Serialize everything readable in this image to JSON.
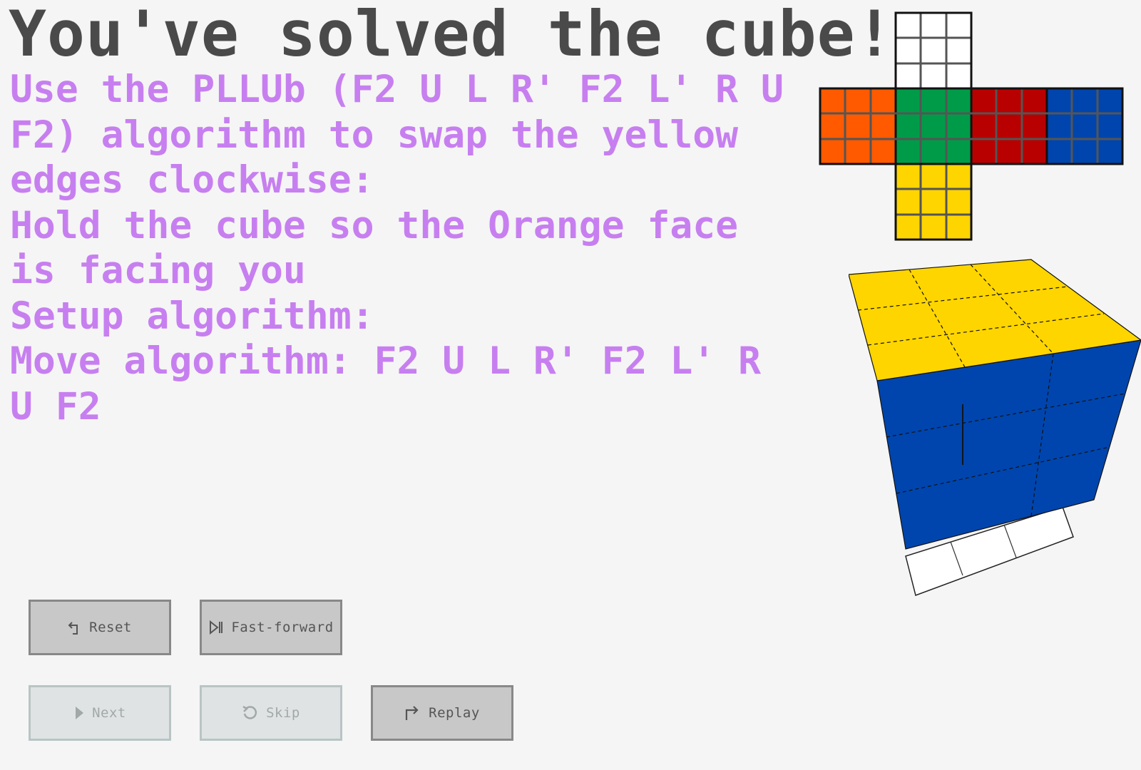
{
  "title": "You've solved the cube!",
  "instructions": {
    "line1": "Use the PLLUb (F2 U L R' F2 L' R U F2) algorithm to swap the yellow edges clockwise:",
    "line2": "Hold the cube so the Orange face is facing you",
    "line3": "Setup algorithm:",
    "line4": "Move algorithm: F2 U L R' F2 L' R U F2"
  },
  "cube_net": {
    "faces": {
      "top": "#ffffff",
      "left": "#ff5a00",
      "front": "#009b48",
      "right": "#b90000",
      "back": "#0045ad",
      "bottom": "#ffd500"
    }
  },
  "cube_3d": {
    "top_color": "#ffd500",
    "front_color": "#0045ad",
    "bottom_color": "#ffffff"
  },
  "buttons": {
    "reset": {
      "label": "Reset",
      "icon": "undo-icon",
      "enabled": true
    },
    "fast_forward": {
      "label": "Fast-forward",
      "icon": "skip-to-end-icon",
      "enabled": true
    },
    "next": {
      "label": "Next",
      "icon": "play-icon",
      "enabled": false
    },
    "skip": {
      "label": "Skip",
      "icon": "rotate-ccw-icon",
      "enabled": false
    },
    "replay": {
      "label": "Replay",
      "icon": "share-arrow-icon",
      "enabled": true
    }
  }
}
